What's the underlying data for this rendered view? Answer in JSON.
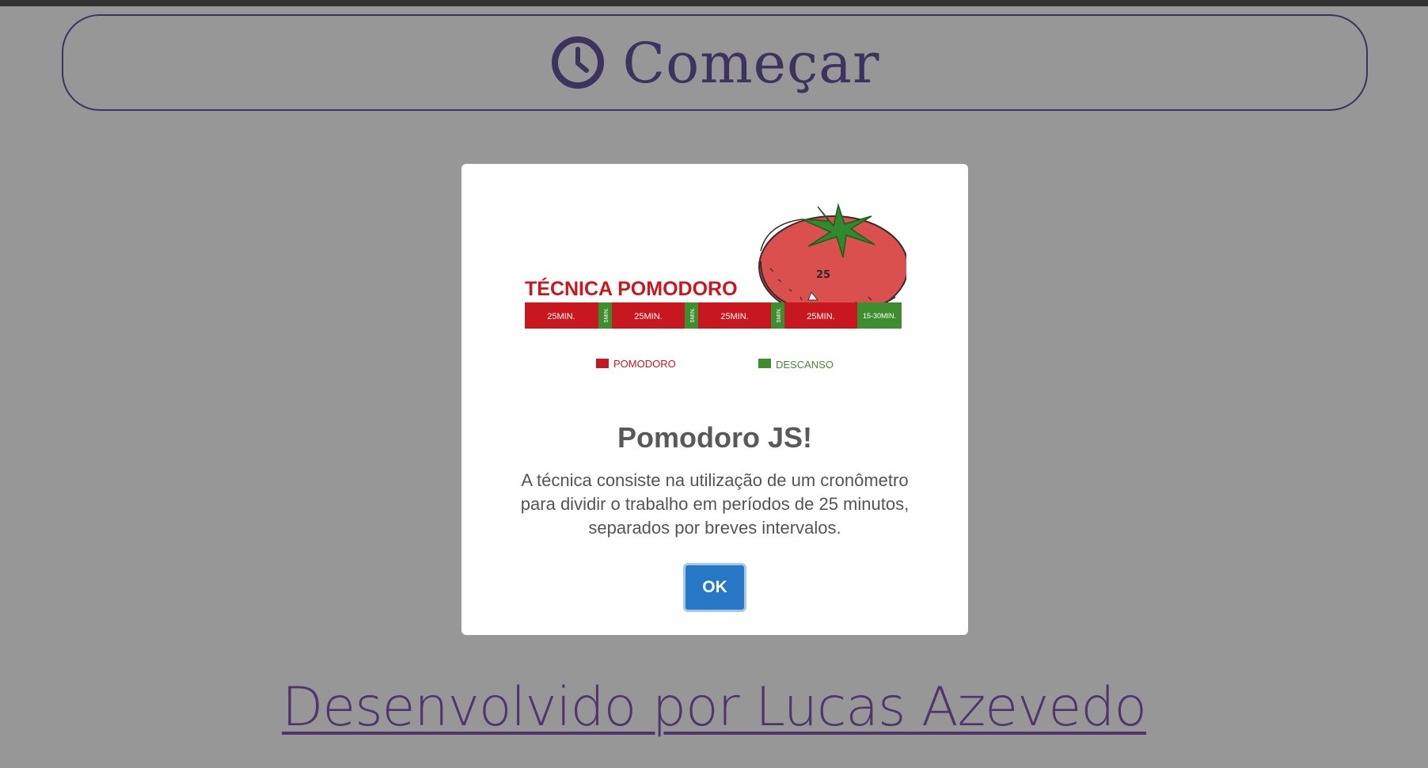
{
  "page": {
    "start_button_label": "Começar",
    "start_button_icon": "clock-icon",
    "footer_link_text": "Desenvolvido por Lucas Azevedo",
    "colors": {
      "accent": "#4d3c8c",
      "link": "#6f3fa6",
      "background": "#f3f3f3"
    }
  },
  "modal": {
    "banner": {
      "title": "TÉCNICA POMODORO",
      "timer_number": "25",
      "segments": [
        "25MIN.",
        "5MIN.",
        "25MIN.",
        "5MIN.",
        "25MIN.",
        "5MIN.",
        "25MIN.",
        "15-30MIN."
      ],
      "legend_work": "POMODORO",
      "legend_break": "DESCANSO",
      "colors": {
        "work": "#c8171e",
        "break": "#3e8e2f",
        "tomato": "#d9504f"
      }
    },
    "title": "Pomodoro JS!",
    "body": "A técnica consiste na utilização de um cronômetro para dividir o trabalho em períodos de 25 minutos, separados por breves intervalos.",
    "ok_label": "OK",
    "ok_color": "#2778c4"
  }
}
